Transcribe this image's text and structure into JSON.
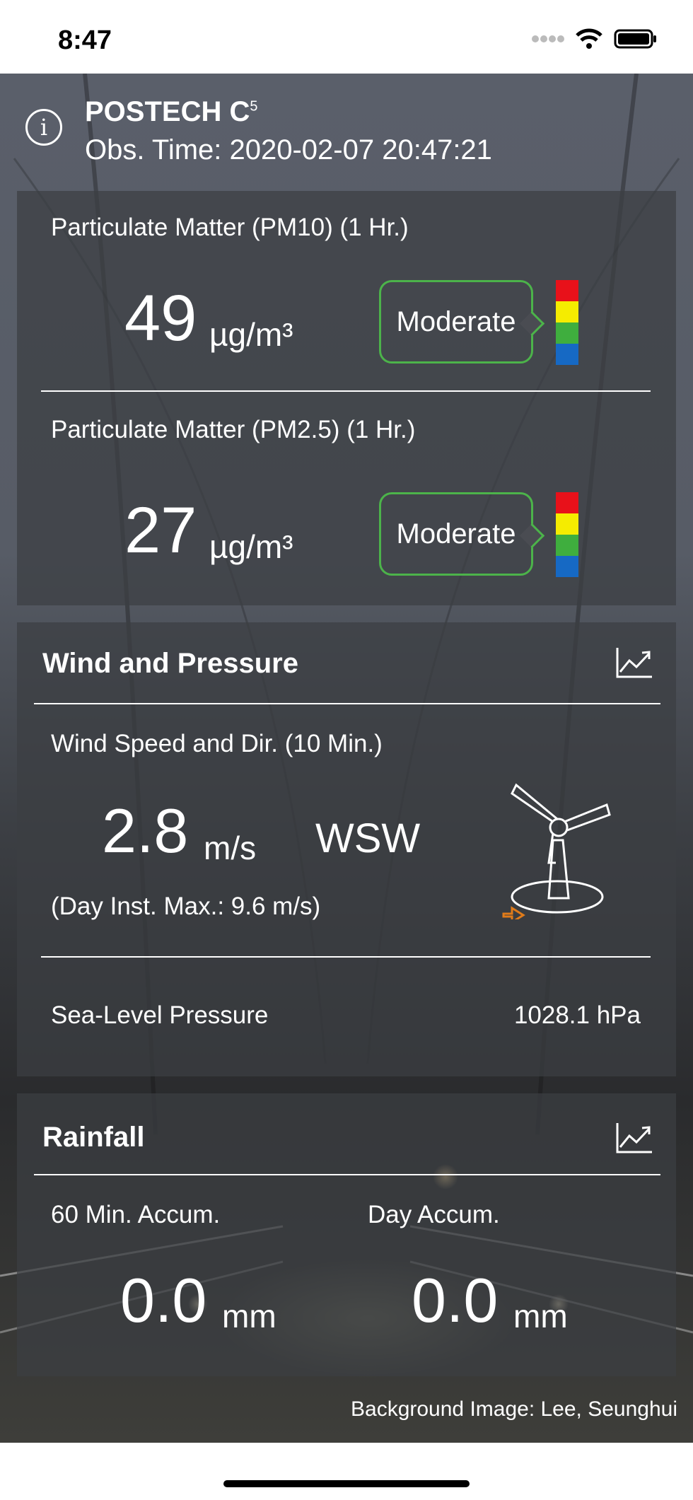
{
  "status_bar": {
    "time": "8:47"
  },
  "header": {
    "station_name": "POSTECH C",
    "station_superscript": "5",
    "obs_time": "Obs. Time: 2020-02-07 20:47:21"
  },
  "air_quality": {
    "pm10": {
      "label": "Particulate Matter (PM10) (1 Hr.)",
      "value": "49",
      "unit": "µg/m³",
      "grade": "Moderate"
    },
    "pm25": {
      "label": "Particulate Matter (PM2.5) (1 Hr.)",
      "value": "27",
      "unit": "µg/m³",
      "grade": "Moderate"
    },
    "scale_colors": [
      "#e8111a",
      "#f5ec00",
      "#3fae3e",
      "#1669c4"
    ]
  },
  "wind_pressure": {
    "title": "Wind and Pressure",
    "wind_label": "Wind Speed and Dir. (10 Min.)",
    "wind_speed": "2.8",
    "wind_unit": "m/s",
    "wind_dir": "WSW",
    "day_max": "(Day Inst. Max.: 9.6 m/s)",
    "pressure_label": "Sea-Level Pressure",
    "pressure_value": "1028.1  hPa"
  },
  "rainfall": {
    "title": "Rainfall",
    "accum60_label": "60 Min. Accum.",
    "accum60_value": "0.0",
    "accumday_label": "Day Accum.",
    "accumday_value": "0.0",
    "unit": "mm"
  },
  "footer": {
    "credit": "Background Image: Lee, Seunghui"
  },
  "colors": {
    "good_border": "#4cb34a",
    "arrow": "#e07b1a"
  }
}
